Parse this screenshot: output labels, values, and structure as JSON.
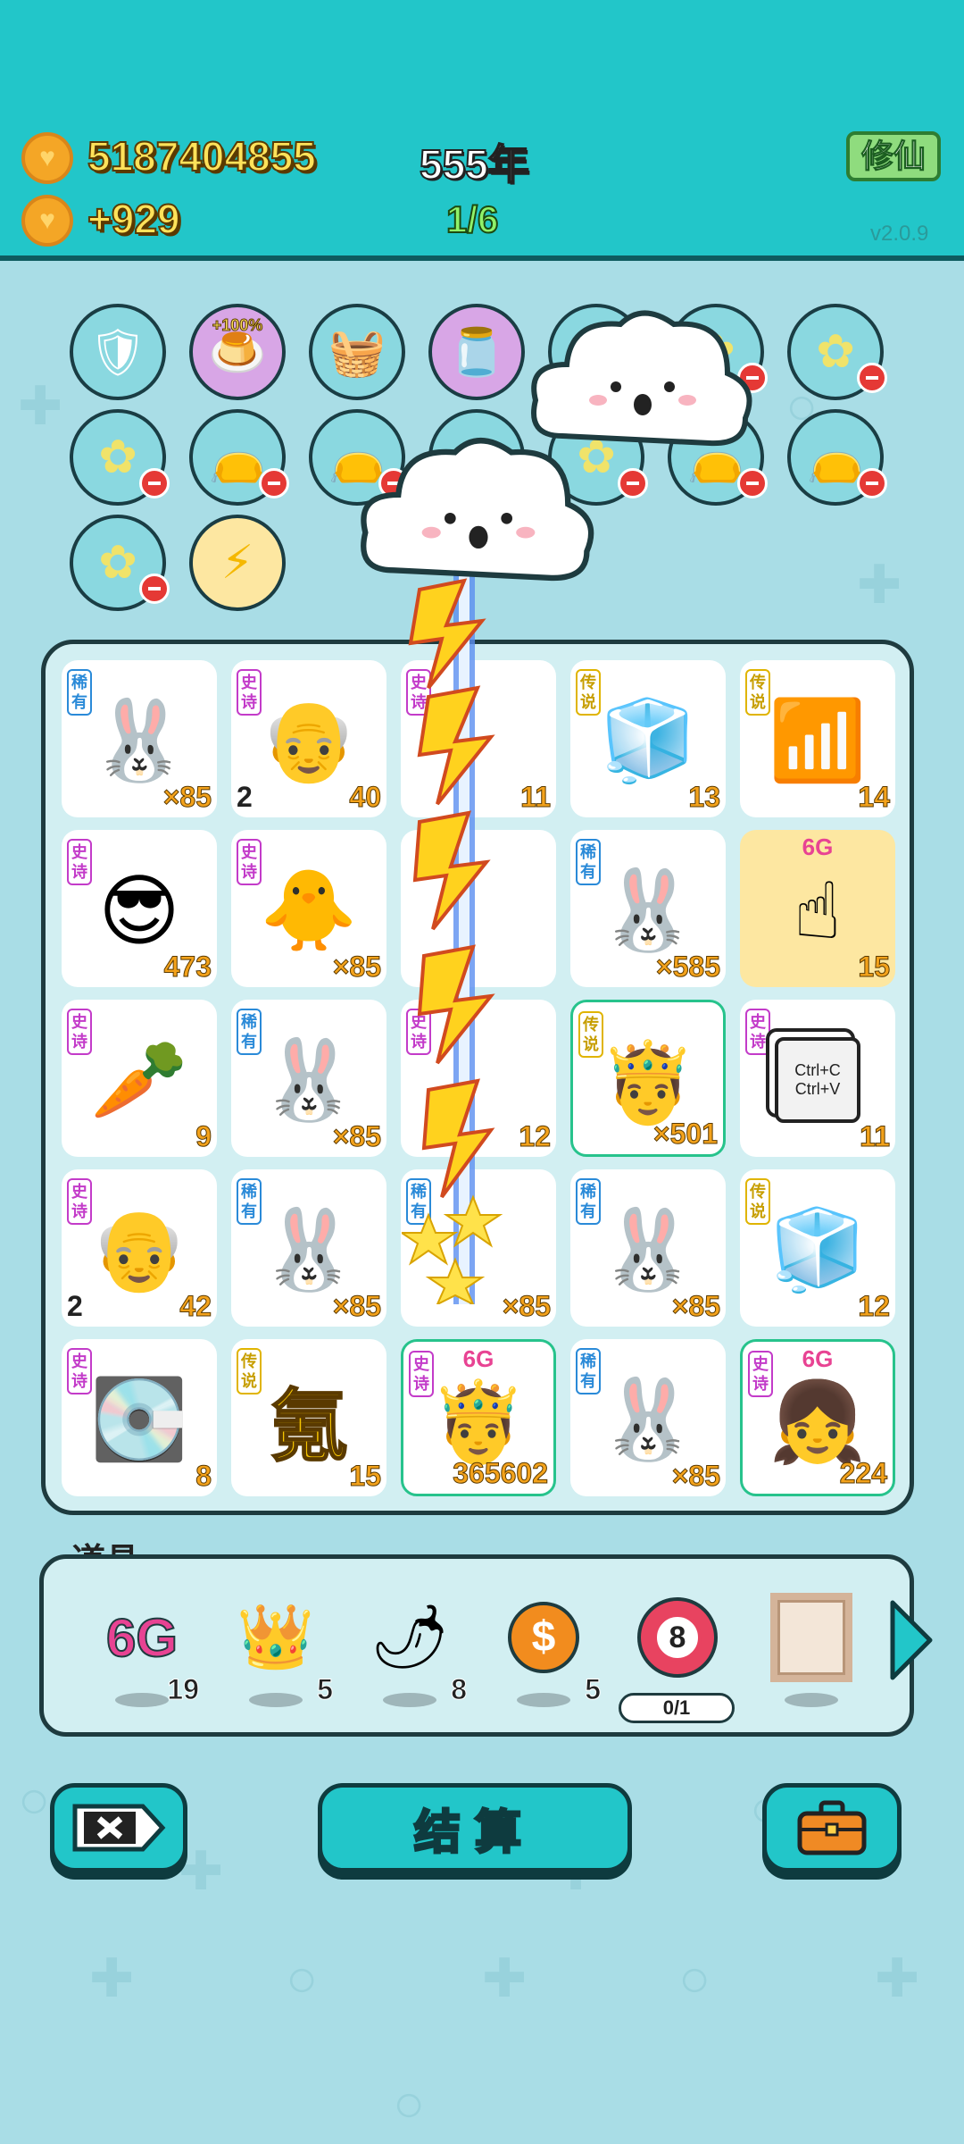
{
  "header": {
    "coins": "5187404855",
    "income": "+929",
    "year": "555年",
    "progress": "1/6",
    "mode_label": "修仙",
    "version": "v2.0.9"
  },
  "relics": [
    {
      "name": "wrench-shield-icon",
      "badge": ""
    },
    {
      "name": "pudding-icon",
      "badge": "+100%"
    },
    {
      "name": "fruit-basket-icon",
      "badge": ""
    },
    {
      "name": "jar-icon",
      "badge": ""
    },
    {
      "name": "flower-pot-icon",
      "badge": ""
    },
    {
      "name": "flower-pot-icon",
      "badge": ""
    },
    {
      "name": "flower-pot-icon",
      "badge": ""
    },
    {
      "name": "flower-pot-icon",
      "badge": ""
    },
    {
      "name": "sack-icon",
      "badge": ""
    },
    {
      "name": "sack-icon",
      "badge": ""
    },
    {
      "name": "flower-pot-icon",
      "badge": ""
    },
    {
      "name": "sack-icon",
      "badge": ""
    },
    {
      "name": "sack-icon",
      "badge": ""
    },
    {
      "name": "flower-pot-icon",
      "badge": ""
    },
    {
      "name": "flower-pot-icon",
      "badge": ""
    },
    {
      "name": "lightning-icon",
      "badge": ""
    }
  ],
  "board": {
    "cells": [
      {
        "rarity": "稀有",
        "icon": "rabbit-icon",
        "count": "×85",
        "left": ""
      },
      {
        "rarity": "史诗",
        "icon": "grandpa-icon",
        "count": "40",
        "left": "2"
      },
      {
        "rarity": "史诗",
        "icon": "",
        "count": "11",
        "left": ""
      },
      {
        "rarity": "传说",
        "icon": "fridge-icon",
        "count": "13",
        "left": ""
      },
      {
        "rarity": "传说",
        "icon": "wifi-icon",
        "count": "14",
        "left": ""
      },
      {
        "rarity": "史诗",
        "icon": "green-hat-man-icon",
        "count": "473",
        "left": ""
      },
      {
        "rarity": "史诗",
        "icon": "chick-man-icon",
        "count": "×85",
        "left": ""
      },
      {
        "rarity": "",
        "icon": "",
        "count": "",
        "left": ""
      },
      {
        "rarity": "稀有",
        "icon": "rabbit-icon",
        "count": "×585",
        "left": ""
      },
      {
        "rarity": "",
        "icon": "pointing-hand-icon",
        "count": "15",
        "left": "",
        "badge": "6G"
      },
      {
        "rarity": "史诗",
        "icon": "carrot-icon",
        "count": "9",
        "left": ""
      },
      {
        "rarity": "稀有",
        "icon": "rabbit-icon",
        "count": "×85",
        "left": ""
      },
      {
        "rarity": "史诗",
        "icon": "",
        "count": "12",
        "left": ""
      },
      {
        "rarity": "传说",
        "icon": "king-icon",
        "count": "×501",
        "left": ""
      },
      {
        "rarity": "史诗",
        "icon": "copy-paste-icon",
        "count": "11",
        "left": "",
        "copy": "Ctrl+C",
        "paste": "Ctrl+V"
      },
      {
        "rarity": "史诗",
        "icon": "grandpa-icon",
        "count": "42",
        "left": "2"
      },
      {
        "rarity": "稀有",
        "icon": "rabbit-icon",
        "count": "×85",
        "left": ""
      },
      {
        "rarity": "稀有",
        "icon": "",
        "count": "×85",
        "left": ""
      },
      {
        "rarity": "稀有",
        "icon": "rabbit-icon",
        "count": "×85",
        "left": ""
      },
      {
        "rarity": "传说",
        "icon": "fridge-icon",
        "count": "12",
        "left": ""
      },
      {
        "rarity": "史诗",
        "icon": "graphics-card-icon",
        "count": "8",
        "left": ""
      },
      {
        "rarity": "传说",
        "icon": "krypton-char-icon",
        "count": "15",
        "left": "",
        "char": "氪"
      },
      {
        "rarity": "史诗",
        "icon": "green-hat-king-icon",
        "count": "365602",
        "left": "",
        "badge": "6G"
      },
      {
        "rarity": "稀有",
        "icon": "rabbit-icon",
        "count": "×85",
        "left": ""
      },
      {
        "rarity": "史诗",
        "icon": "girl-icon",
        "count": "224",
        "left": "",
        "badge": "6G"
      }
    ]
  },
  "items": {
    "label": "道具",
    "list": [
      {
        "icon": "6g-icon",
        "text": "6G",
        "count": "19"
      },
      {
        "icon": "crown-icon",
        "count": "5"
      },
      {
        "icon": "chili-icon",
        "count": "8"
      },
      {
        "icon": "dollar-coin-icon",
        "count": "5"
      },
      {
        "icon": "target-8-icon",
        "number": "8",
        "count": "0/1"
      },
      {
        "icon": "frame-icon",
        "count": ""
      }
    ]
  },
  "buttons": {
    "settle": "结算"
  },
  "colors": {
    "header_bg": "#22c6c9",
    "page_bg": "#a9dde6",
    "epic": "#c33bc9",
    "rare": "#2a8ad8",
    "legend": "#e0b400"
  }
}
